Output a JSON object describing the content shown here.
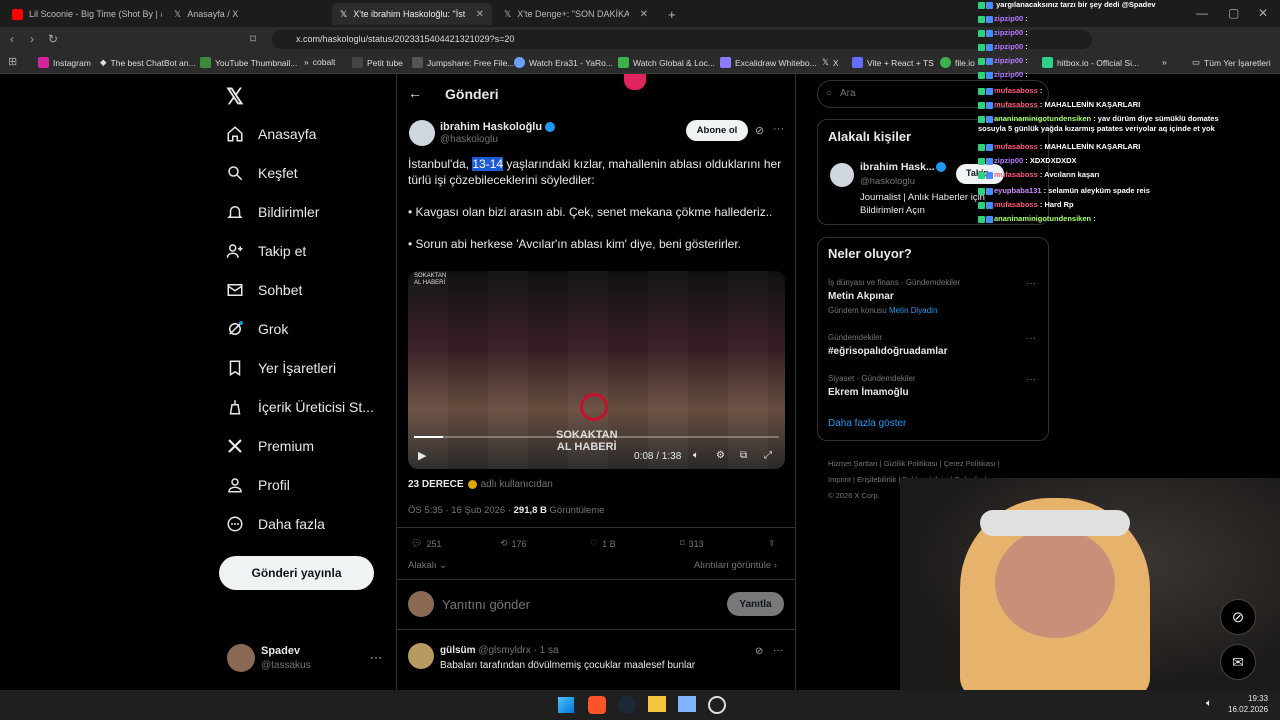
{
  "tabs": [
    {
      "label": "Lil Scoonie - Big Time (Shot By | @ey"
    },
    {
      "label": "Anasayfa / X"
    },
    {
      "label": "X'te ibrahim Haskoloğlu: \"İstanb"
    },
    {
      "label": "X'te Denge+: \"SON DAKİKA: Gözalt"
    }
  ],
  "url": "x.com/haskologlu/status/2023315404421321029?s=20",
  "bookmarks": [
    "Instagram",
    "The best ChatBot an...",
    "YouTube Thumbnail...",
    "cobalt",
    "Petit tube",
    "Jumpshare: Free File...",
    "Watch Era31 - YaRo...",
    "Watch Global & Loc...",
    "Excalidraw Whitebo...",
    "X",
    "Vite + React + TS",
    "file.io",
    "hitbox.io - Official Si...",
    "Tüm Yer İşaretleri"
  ],
  "nav": [
    {
      "label": "Anasayfa"
    },
    {
      "label": "Keşfet"
    },
    {
      "label": "Bildirimler"
    },
    {
      "label": "Takip et"
    },
    {
      "label": "Sohbet"
    },
    {
      "label": "Grok"
    },
    {
      "label": "Yer İşaretleri"
    },
    {
      "label": "İçerik Üreticisi St..."
    },
    {
      "label": "Premium"
    },
    {
      "label": "Profil"
    },
    {
      "label": "Daha fazla"
    }
  ],
  "post_button": "Gönderi yayınla",
  "account": {
    "name": "Spadev",
    "handle": "@tassakus"
  },
  "header": {
    "title": "Gönderi"
  },
  "tweet": {
    "author": "ibrahim Haskoloğlu",
    "handle": "@haskologlu",
    "subscribe": "Abone ol",
    "text_pre": "İstanbul'da, ",
    "text_hl": "13-14",
    "text_post": " yaşlarındaki kızlar, mahallenin ablası olduklarını her türlü işi çözebileceklerini söylediler:",
    "bullet1": "• Kavgası olan bizi arasın abi. Çek, senet mekana çökme hallederiz..",
    "bullet2": "• Sorun abi herkese 'Avcılar'ın ablası kim' diye, beni gösterirler.",
    "video_time": "0:08 / 1:38",
    "video_progress": 0.08,
    "video_brand1": "SOKAKTAN",
    "video_brand2": "AL HABERİ",
    "source_name": "23 DERECE",
    "source_note": "adlı kullanıcıdan",
    "time": "ÖS 5:35 · 16 Şub 2026 · ",
    "views": "291,8 B",
    "views_label": "Görüntüleme",
    "replies": "251",
    "retweets": "176",
    "likes": "1 B",
    "bookmarks": "313",
    "relevant": "Alakalı",
    "quotes": "Alıntıları görüntüle"
  },
  "reply_box": {
    "placeholder": "Yanıtını gönder",
    "button": "Yanıtla"
  },
  "reply": {
    "name": "gülsüm",
    "handle": "@glsmyldrx · 1 sa",
    "text": "Babaları tarafından dövülmemiş çocuklar maalesef bunlar"
  },
  "search": {
    "placeholder": "Ara"
  },
  "related": {
    "title": "Alakalı kişiler",
    "name": "ibrahim Hask...",
    "handle": "@haskologlu",
    "bio": "Journalist | Anlık Haberler için Bildirimleri Açın",
    "follow": "Takip"
  },
  "trends": {
    "title": "Neler oluyor?",
    "items": [
      {
        "ctx": "İş dünyası ve finans · Gündemdekiler",
        "name": "Metin Akpınar",
        "extra": "Gündem konusu ",
        "extra_link": "Metin Diyadin"
      },
      {
        "ctx": "Gündemdekiler",
        "name": "#eğrisopalıdoğruadamlar"
      },
      {
        "ctx": "Siyaset · Gündemdekiler",
        "name": "Ekrem İmamoğlu"
      }
    ],
    "more": "Daha fazla göster"
  },
  "footer": [
    "Hizmet Şartları",
    "Gizlilik Politikası",
    "Çerez Politikası",
    "Imprint",
    "Erişilebilirlik",
    "Reklam bilgisi",
    "Daha fazla ...",
    "© 2026 X Corp."
  ],
  "chat": [
    {
      "user": "",
      "msg": "yargılanacaksınız tarzı bir şey dedi @Spadev"
    },
    {
      "user": "zipzip00",
      "msg": ":"
    },
    {
      "user": "zipzip00",
      "msg": ":"
    },
    {
      "user": "zipzip00",
      "msg": ":"
    },
    {
      "user": "zipzip00",
      "msg": ":"
    },
    {
      "user": "zipzip00",
      "msg": ":"
    },
    {
      "user": "mufasaboss",
      "msg": ":"
    },
    {
      "user": "mufasaboss",
      "msg": ": MAHALLENİN KAŞARLARI"
    },
    {
      "user": "ananinaminigotundensiken",
      "msg": ": yav dürüm diye sümüklü domates sosuyla 5 günlük yağda kızarmış patates veriyolar aq içinde et yok"
    },
    {
      "user": "mufasaboss",
      "msg": ": MAHALLENİN KAŞARLARI"
    },
    {
      "user": "zipzip00",
      "msg": ": XDXDXDXDX"
    },
    {
      "user": "mufasaboss",
      "msg": ": Avcıların kaşarı"
    },
    {
      "user": "eyupbaba131",
      "msg": ": selamün aleyküm spade reis"
    },
    {
      "user": "mufasaboss",
      "msg": ": Hard Rp"
    },
    {
      "user": "ananinaminigotundensiken",
      "msg": ":"
    }
  ],
  "clock": {
    "time": "19:33",
    "date": "16.02.2026"
  }
}
